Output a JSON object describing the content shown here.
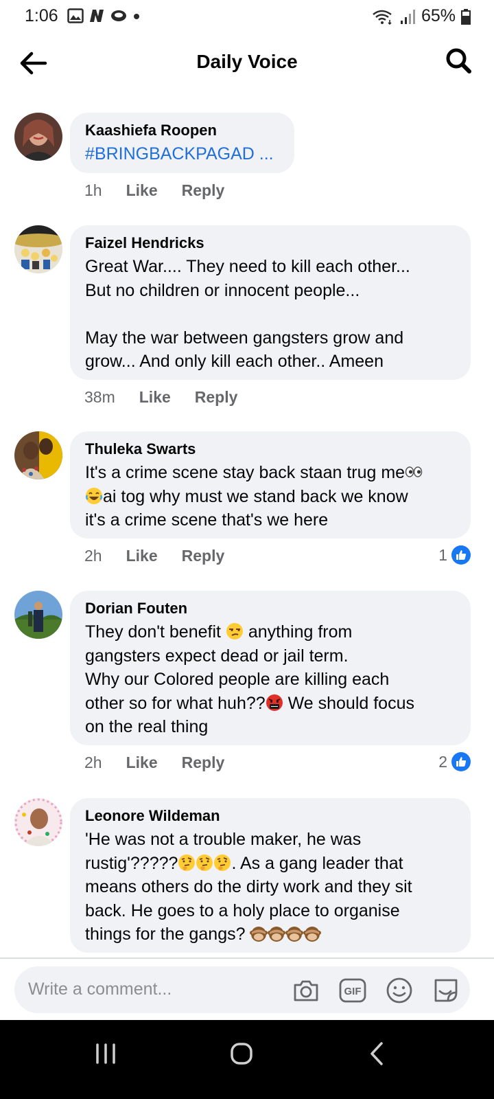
{
  "status_bar": {
    "time": "1:06",
    "battery": "65%",
    "left_icons": [
      "gallery-icon",
      "n-app-icon",
      "snapchat-icon",
      "dot-icon"
    ],
    "right_icons": [
      "wifi-icon",
      "signal-icon",
      "battery-icon"
    ]
  },
  "header": {
    "title": "Daily Voice",
    "back_icon": "back-arrow-icon",
    "search_icon": "search-icon"
  },
  "comments": [
    {
      "author": "Kaashiefa Roopen",
      "text": "#BRINGBACKPAGAD ...",
      "time": "1h",
      "like_label": "Like",
      "reply_label": "Reply",
      "reactions": null
    },
    {
      "author": "Faizel Hendricks",
      "text": "Great War.... They need to kill each other...\nBut no children or innocent people...\n\nMay the war between gangsters grow and\ngrow... And only kill each other.. Ameen",
      "time": "38m",
      "like_label": "Like",
      "reply_label": "Reply",
      "reactions": null
    },
    {
      "author": "Thuleka Swarts",
      "text_parts": [
        "It's a crime scene stay back staan trug me",
        "ai tog why must we stand back we know",
        "it's a crime scene that's we here"
      ],
      "emojis": [
        "eyes-emoji",
        "joy-emoji"
      ],
      "time": "2h",
      "like_label": "Like",
      "reply_label": "Reply",
      "reactions": "1"
    },
    {
      "author": "Dorian Fouten",
      "text_parts": [
        "They don't benefit",
        "anything from",
        "gangsters expect dead or jail term.",
        "Why our Colored people are killing each",
        "other so for what huh??",
        "We should focus",
        "on the real thing"
      ],
      "emojis": [
        "unamused-emoji",
        "cursing-emoji"
      ],
      "time": "2h",
      "like_label": "Like",
      "reply_label": "Reply",
      "reactions": "2"
    },
    {
      "author": "Leonore Wildeman",
      "text_parts": [
        "'He was not a trouble maker, he was",
        "rustig'?????",
        ". As a gang leader that",
        "means others do the dirty work and they sit",
        "back. He goes to a holy place to organise",
        "things for the gangs?"
      ],
      "emojis": [
        "thinking-emoji",
        "thinking-emoji",
        "thinking-emoji",
        "see-no-evil-monkey-emoji",
        "see-no-evil-monkey-emoji",
        "see-no-evil-monkey-emoji",
        "see-no-evil-monkey-emoji"
      ],
      "time": null,
      "reactions": null
    }
  ],
  "composer": {
    "placeholder": "Write a comment...",
    "icons": [
      "camera-icon",
      "gif-icon",
      "emoji-icon",
      "sticker-icon"
    ]
  },
  "nav_bar": {
    "icons": [
      "recent-apps-icon",
      "home-icon",
      "back-icon"
    ]
  },
  "colors": {
    "bubble_bg": "#f0f2f5",
    "link": "#216fdb",
    "meta_text": "#65676b",
    "like_blue": "#1877f2"
  }
}
